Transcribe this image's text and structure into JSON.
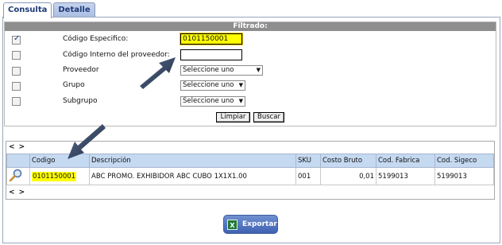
{
  "tabs": [
    {
      "label": "Consulta",
      "active": true
    },
    {
      "label": "Detalle",
      "active": false
    }
  ],
  "filter": {
    "header": "Filtrado:",
    "rows": [
      {
        "label": "Código Especifico:",
        "checked": true,
        "value": "0101150001"
      },
      {
        "label": "Código Interno del proveedor:",
        "checked": false,
        "value": ""
      },
      {
        "label": "Proveedor",
        "checked": false,
        "value": "Seleccione uno"
      },
      {
        "label": "Grupo",
        "checked": false,
        "value": "Seleccione uno"
      },
      {
        "label": "Subgrupo",
        "checked": false,
        "value": "Seleccione uno"
      }
    ],
    "buttons": {
      "clear": "Limpiar",
      "search": "Buscar"
    }
  },
  "results": {
    "nav_top": "< >",
    "nav_bottom": "< >",
    "columns": [
      "Codigo",
      "Descripción",
      "SKU",
      "Costo Bruto",
      "Cod. Fabrica",
      "Cod. Sigeco"
    ],
    "rows": [
      {
        "codigo": "0101150001",
        "descripcion": "ABC PROMO. EXHIBIDOR ABC CUBO 1X1X1.00",
        "sku": "001",
        "costo_bruto": "0,01",
        "cod_fabrica": "5199013",
        "cod_sigeco": "5199013"
      }
    ]
  },
  "export": {
    "label": "Exportar",
    "icon": "excel-icon"
  },
  "colors": {
    "highlight": "#ffff00",
    "header_bar": "#8e8e8e",
    "table_header": "#c5d9f1",
    "button_blue": "#3f62b2"
  }
}
